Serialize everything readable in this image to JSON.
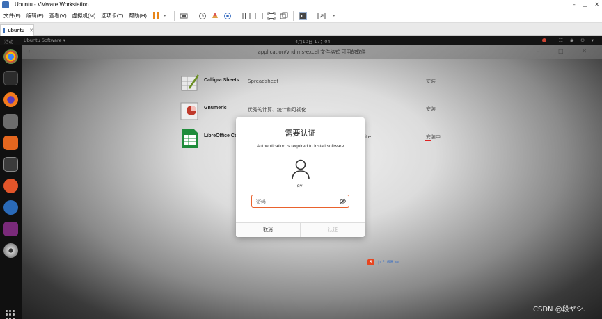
{
  "host": {
    "window_title": "Ubuntu - VMware Workstation",
    "window_controls": [
      "–",
      "□",
      "✕"
    ],
    "menus": [
      "文件(F)",
      "编辑(E)",
      "查看(V)",
      "虚拟机(M)",
      "选项卡(T)",
      "帮助(H)"
    ],
    "tab": {
      "label": "ubuntu",
      "close": "✕"
    },
    "accent_color": "#e8861a"
  },
  "guest": {
    "topbar": {
      "activities": "活动",
      "app_menu": "Ubuntu Software ▾",
      "clock": "4月10日 17：04",
      "tray": "☷ ◉ ⏻ ▾"
    },
    "window": {
      "title": "application/vnd.ms-excel 文件格式 可用的软件",
      "back": "‹",
      "controls": "– □ ✕"
    },
    "apps": [
      {
        "name": "Calligra Sheets",
        "desc": "Spreadsheet",
        "action": "安装",
        "color": "#6b8e23"
      },
      {
        "name": "Gnumeric",
        "desc": "优秀的计算、统计和可视化",
        "action": "安装",
        "color": "#c0392b"
      },
      {
        "name": "LibreOffice Ca",
        "desc": "ite",
        "action": "安装中",
        "color": "#1e8c3a"
      }
    ],
    "ime": [
      "S",
      "中",
      "°",
      "⌨",
      "⚙"
    ],
    "dialog": {
      "title": "需要认证",
      "subtitle": "Authentication is required to install software",
      "user": "gyl",
      "password_placeholder": "密码",
      "cancel": "取消",
      "confirm": "认证",
      "accent_color": "#e9622d"
    }
  },
  "watermark": "CSDN @段ヤシ."
}
